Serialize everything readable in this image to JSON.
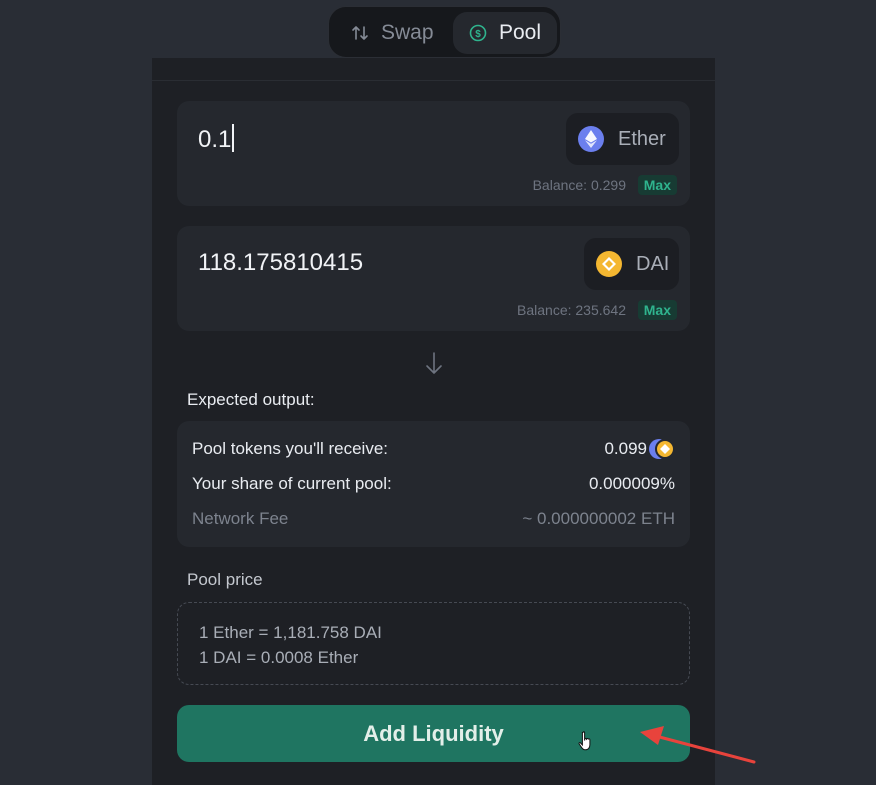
{
  "nav": {
    "tabs": [
      {
        "label": "Swap",
        "icon": "swap-arrows-icon",
        "active": false
      },
      {
        "label": "Pool",
        "icon": "dollar-coin-icon",
        "active": true
      }
    ]
  },
  "input_a": {
    "amount": "0.1",
    "token": "Ether",
    "token_icon": "ethereum-icon",
    "balance": "Balance: 0.299",
    "max_label": "Max"
  },
  "input_b": {
    "amount": "118.175810415",
    "token": "DAI",
    "token_icon": "dai-icon",
    "balance": "Balance: 235.642",
    "max_label": "Max"
  },
  "expected": {
    "title": "Expected output:",
    "rows": [
      {
        "label": "Pool tokens you'll receive:",
        "value": "0.099"
      },
      {
        "label": "Your share of current pool:",
        "value": "0.000009%"
      },
      {
        "label": "Network Fee",
        "value": "~ 0.000000002 ETH"
      }
    ]
  },
  "pool_price": {
    "title": "Pool price",
    "lines": [
      "1 Ether = 1,181.758 DAI",
      "1 DAI = 0.0008 Ether"
    ]
  },
  "action": {
    "label": "Add Liquidity"
  },
  "colors": {
    "accent": "#1f7561",
    "max_text": "#2fb48e",
    "annotation_arrow": "#e8433c"
  }
}
